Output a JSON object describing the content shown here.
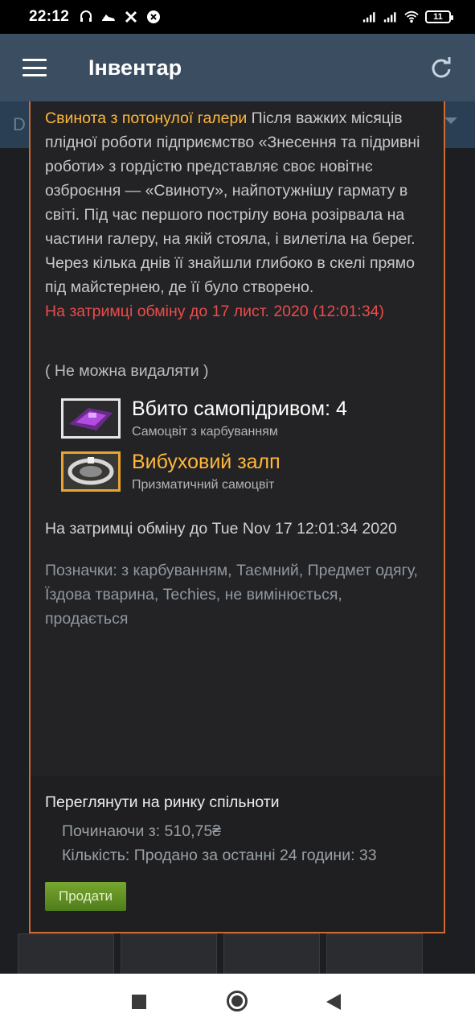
{
  "status_bar": {
    "time": "22:12",
    "battery": "11"
  },
  "app_bar": {
    "title": "Інвентар"
  },
  "background": {
    "dropdown_initial": "D"
  },
  "item": {
    "name": "Свинота з потонулої галери",
    "description": "Після важких місяців плідної роботи підприємство «Знесення та підривні роботи» з гордістю представляє своє новітнє озброєння — «Свиноту», найпотужнішу гармату в світі. Під час першого пострілу вона розірвала на частини галеру, на якій стояла, і вилетіла на берег. Через кілька днів її знайшли глибоко в скелі прямо під майстернею, де її було створено.",
    "trade_hold_red": "На затримці обміну до 17 лист. 2020 (12:01:34)",
    "not_removable": "( Не можна видаляти )",
    "gems": [
      {
        "title": "Вбито самопідривом: 4",
        "subtitle": "Самоцвіт з карбуванням"
      },
      {
        "title": "Вибуховий залп",
        "subtitle": "Призматичний самоцвіт"
      }
    ],
    "trade_hold": "На затримці обміну до Tue Nov 17 12:01:34 2020",
    "tags": "Позначки: з карбуванням, Таємний, Предмет одягу, Їздова тварина, Techies, не вимінюється, продається"
  },
  "market": {
    "link": "Переглянути на ринку спільноти",
    "starting_at": "Починаючи з: 510,75₴",
    "quantity": "Кількість: Продано за останні 24 години: 33",
    "sell_button": "Продати"
  },
  "colors": {
    "popup_border": "#cf6a32",
    "item_name": "#ffb73b",
    "trade_hold_red": "#eb4b4b",
    "sell_button": "#5c8a23",
    "app_bar": "#3b4d61"
  }
}
